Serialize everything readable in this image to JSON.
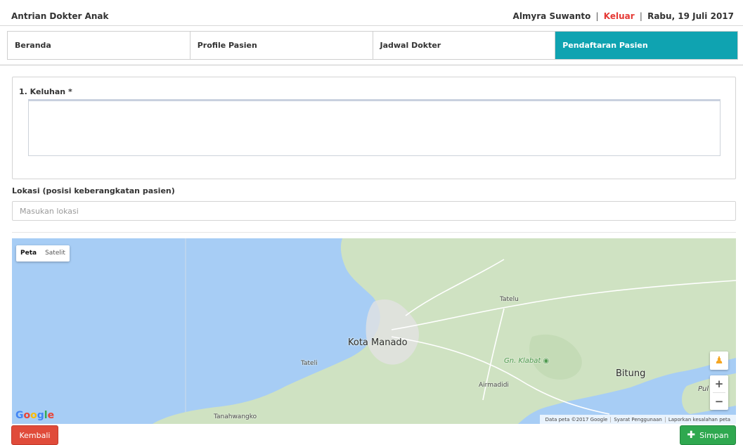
{
  "header": {
    "app_title": "Antrian Dokter Anak",
    "user_name": "Almyra Suwanto",
    "logout_label": "Keluar",
    "date": "Rabu, 19 Juli 2017",
    "separator": "|"
  },
  "nav": {
    "tabs": [
      {
        "label": "Beranda",
        "active": false
      },
      {
        "label": "Profile Pasien",
        "active": false
      },
      {
        "label": "Jadwal Dokter",
        "active": false
      },
      {
        "label": "Pendaftaran Pasien",
        "active": true
      }
    ]
  },
  "form": {
    "complaint_label": "1. Keluhan *",
    "complaint_value": "",
    "location_label": "Lokasi (posisi keberangkatan pasien)",
    "location_placeholder": "Masukan lokasi",
    "location_value": ""
  },
  "map": {
    "type_options": [
      "Peta",
      "Satelit"
    ],
    "selected_type": "Peta",
    "places": {
      "kota_manado": "Kota Manado",
      "tatelu": "Tatelu",
      "tateli": "Tateli",
      "gn_klabat": "Gn. Klabat",
      "bitung": "Bitung",
      "airmadidi": "Airmadidi",
      "tanahwangko": "Tanahwangko",
      "pulau": "Pul"
    },
    "logo": "Google",
    "attribution": {
      "data": "Data peta ©2017 Google",
      "terms": "Syarat Penggunaan",
      "report": "Laporkan kesalahan peta"
    },
    "zoom_in": "+",
    "zoom_out": "−",
    "colors": {
      "water": "#a7cdf5",
      "land": "#cfe2c2",
      "urban": "#e2e2e2"
    }
  },
  "actions": {
    "back_label": "Kembali",
    "save_label": "Simpan"
  },
  "colors": {
    "accent": "#0fa3b1",
    "danger": "#e04b3a",
    "success": "#2fa84f",
    "logout": "#e53935"
  }
}
